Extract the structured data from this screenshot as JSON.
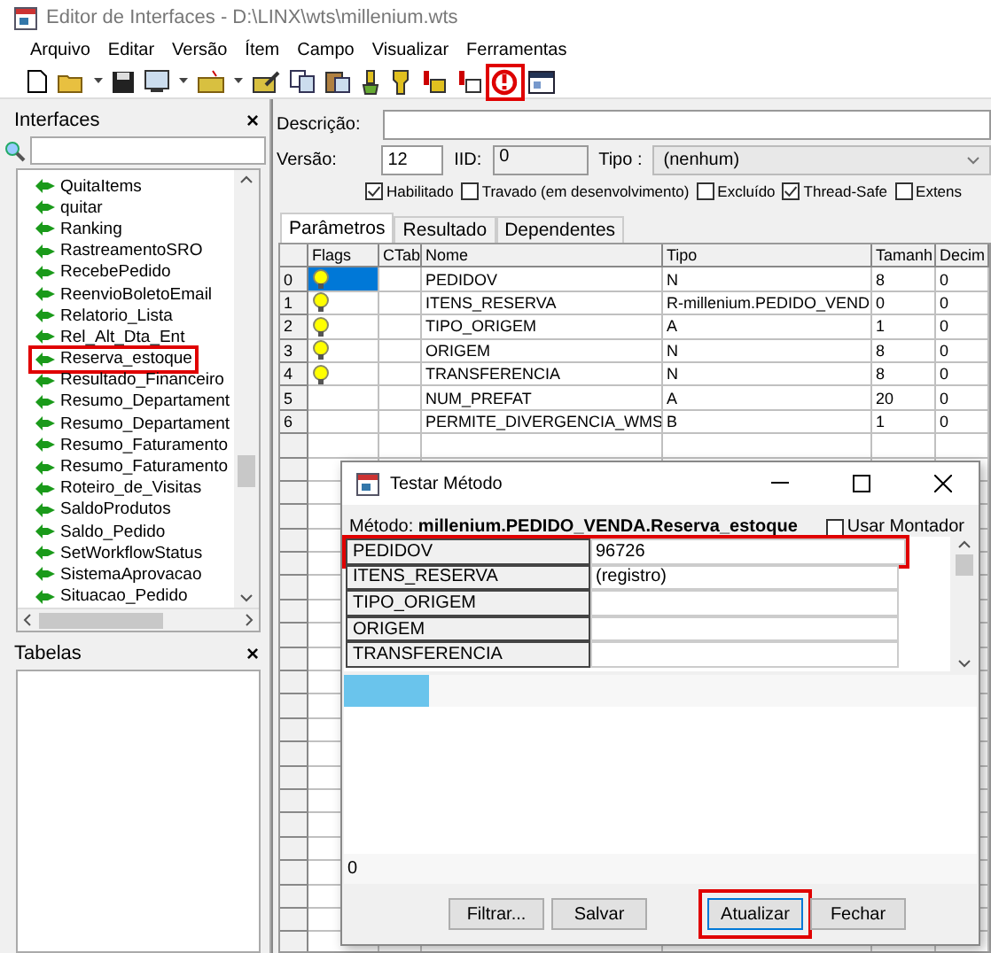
{
  "window": {
    "title": "Editor de Interfaces - D:\\LINX\\wts\\millenium.wts"
  },
  "menu": [
    "Arquivo",
    "Editar",
    "Versão",
    "Ítem",
    "Campo",
    "Visualizar",
    "Ferramentas"
  ],
  "toolbar": [
    {
      "kind": "new",
      "highlighted": false
    },
    {
      "kind": "open",
      "highlighted": false
    },
    {
      "kind": "caret",
      "highlighted": false
    },
    {
      "kind": "save",
      "highlighted": false
    },
    {
      "kind": "preview",
      "highlighted": false
    },
    {
      "kind": "caret",
      "highlighted": false
    },
    {
      "kind": "add",
      "highlighted": false
    },
    {
      "kind": "caret",
      "highlighted": false
    },
    {
      "kind": "edit",
      "highlighted": false
    },
    {
      "kind": "copy",
      "highlighted": false
    },
    {
      "kind": "paste",
      "highlighted": false
    },
    {
      "kind": "brush",
      "highlighted": false
    },
    {
      "kind": "pin",
      "highlighted": false
    },
    {
      "kind": "field-add",
      "highlighted": false
    },
    {
      "kind": "field-edit",
      "highlighted": false
    },
    {
      "kind": "test",
      "highlighted": true
    },
    {
      "kind": "form",
      "highlighted": false
    }
  ],
  "interfaces_panel": {
    "title": "Interfaces",
    "close": "×",
    "items": [
      {
        "label": "QuitaItems",
        "highlighted": false
      },
      {
        "label": "quitar",
        "highlighted": false
      },
      {
        "label": "Ranking",
        "highlighted": false
      },
      {
        "label": "RastreamentoSRO",
        "highlighted": false
      },
      {
        "label": "RecebePedido",
        "highlighted": false
      },
      {
        "label": "ReenvioBoletoEmail",
        "highlighted": false
      },
      {
        "label": "Relatorio_Lista",
        "highlighted": false
      },
      {
        "label": "Rel_Alt_Dta_Ent",
        "highlighted": false
      },
      {
        "label": "Reserva_estoque",
        "highlighted": true
      },
      {
        "label": "Resultado_Financeiro",
        "highlighted": false
      },
      {
        "label": "Resumo_Departament",
        "highlighted": false
      },
      {
        "label": "Resumo_Departament",
        "highlighted": false
      },
      {
        "label": "Resumo_Faturamento",
        "highlighted": false
      },
      {
        "label": "Resumo_Faturamento",
        "highlighted": false
      },
      {
        "label": "Roteiro_de_Visitas",
        "highlighted": false
      },
      {
        "label": "SaldoProdutos",
        "highlighted": false
      },
      {
        "label": "Saldo_Pedido",
        "highlighted": false
      },
      {
        "label": "SetWorkflowStatus",
        "highlighted": false
      },
      {
        "label": "SistemaAprovacao",
        "highlighted": false
      },
      {
        "label": "Situacao_Pedido",
        "highlighted": false
      }
    ]
  },
  "tables_panel": {
    "title": "Tabelas",
    "close": "×"
  },
  "form": {
    "descricao_label": "Descrição:",
    "versao_label": "Versão:",
    "versao": "12",
    "iid_label": "IID:",
    "iid": "0",
    "tipo_label": "Tipo :",
    "tipo": "(nenhum)",
    "checkboxes": [
      {
        "label": "Habilitado",
        "checked": true
      },
      {
        "label": "Travado (em desenvolvimento)",
        "checked": false
      },
      {
        "label": "Excluído",
        "checked": false
      },
      {
        "label": "Thread-Safe",
        "checked": true
      },
      {
        "label": "Extens",
        "checked": false
      }
    ]
  },
  "tabs": [
    {
      "label": "Parâmetros",
      "selected": true
    },
    {
      "label": "Resultado",
      "selected": false
    },
    {
      "label": "Dependentes",
      "selected": false
    }
  ],
  "params_table": {
    "columns": [
      "Flags",
      "CTab",
      "Nome",
      "Tipo",
      "Tamanh",
      "Decim"
    ],
    "rows": [
      {
        "index": "0",
        "flag": true,
        "selected": true,
        "nome": "PEDIDOV",
        "tipo": "N",
        "tamanho": "8",
        "decimais": "0"
      },
      {
        "index": "1",
        "flag": true,
        "selected": false,
        "nome": "ITENS_RESERVA",
        "tipo": "R-millenium.PEDIDO_VEND",
        "tamanho": "0",
        "decimais": "0"
      },
      {
        "index": "2",
        "flag": true,
        "selected": false,
        "nome": "TIPO_ORIGEM",
        "tipo": "A",
        "tamanho": "1",
        "decimais": "0"
      },
      {
        "index": "3",
        "flag": true,
        "selected": false,
        "nome": "ORIGEM",
        "tipo": "N",
        "tamanho": "8",
        "decimais": "0"
      },
      {
        "index": "4",
        "flag": true,
        "selected": false,
        "nome": "TRANSFERENCIA",
        "tipo": "N",
        "tamanho": "8",
        "decimais": "0"
      },
      {
        "index": "5",
        "flag": false,
        "selected": false,
        "nome": "NUM_PREFAT",
        "tipo": "A",
        "tamanho": "20",
        "decimais": "0"
      },
      {
        "index": "6",
        "flag": false,
        "selected": false,
        "nome": "PERMITE_DIVERGENCIA_WMS",
        "tipo": "B",
        "tamanho": "1",
        "decimais": "0"
      }
    ]
  },
  "dialog": {
    "title": "Testar Método",
    "metodo_label": "Método:",
    "metodo": "millenium.PEDIDO_VENDA.Reserva_estoque",
    "usar_montador": {
      "label": "Usar Montador",
      "checked": false
    },
    "params": [
      {
        "name": "PEDIDOV",
        "value": "96726",
        "highlighted": true
      },
      {
        "name": "ITENS_RESERVA",
        "value": "(registro)",
        "highlighted": false
      },
      {
        "name": "TIPO_ORIGEM",
        "highlighted": false
      },
      {
        "name": "ORIGEM",
        "highlighted": false
      },
      {
        "name": "TRANSFERENCIA",
        "highlighted": false
      }
    ],
    "count": "0",
    "buttons": [
      {
        "label": "Filtrar...",
        "highlighted": false
      },
      {
        "label": "Salvar",
        "highlighted": false
      },
      {
        "label": "Atualizar",
        "highlighted": true
      },
      {
        "label": "Fechar",
        "highlighted": false
      }
    ]
  }
}
